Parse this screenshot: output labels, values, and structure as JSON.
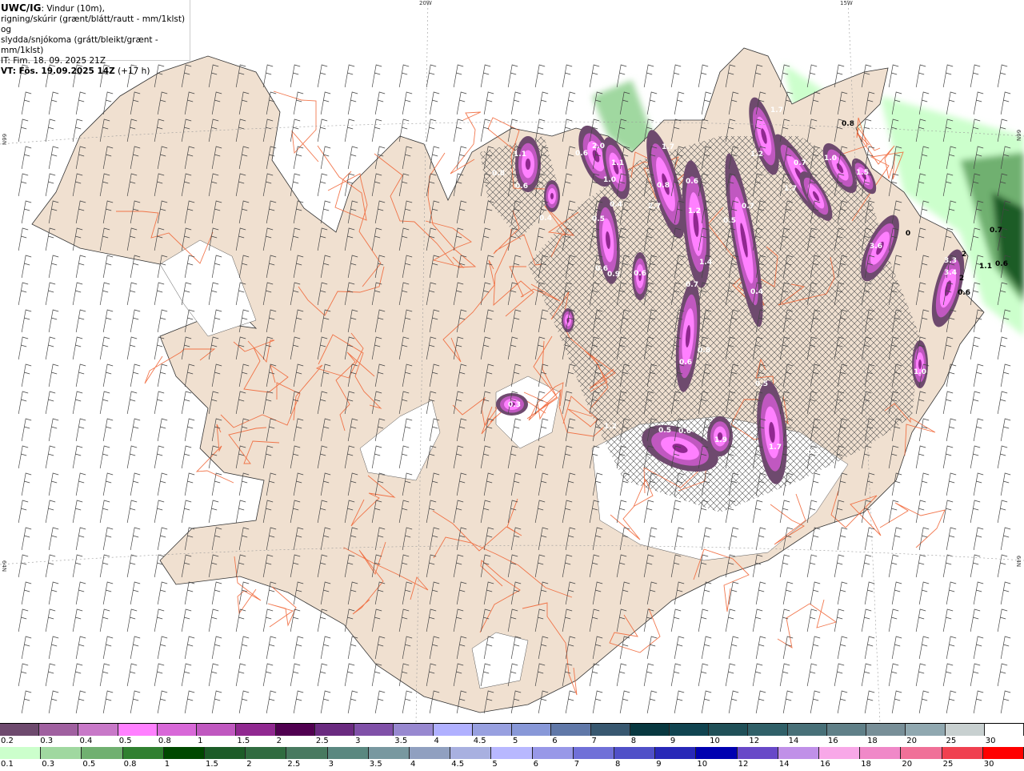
{
  "title": {
    "model": "UWC/IG",
    "line1": ": Vindur (10m),",
    "line2": "rigning/skúrir (grænt/blátt/rautt - mm/1klst) og",
    "line3": "slydda/snjókoma (grátt/bleikt/grænt - mm/1klst)",
    "it": "IT: Fim. 18. 09. 2025 21Z",
    "vt_bold": "VT: Fös. 19.09.2025 14Z",
    "vt_rest": " (+17 h)"
  },
  "graticule": {
    "lon1": "20W",
    "lon2": "15W",
    "lat_left_top": "66N",
    "lat_right_top": "66N",
    "lat_left_bottom": "64N",
    "lat_right_bottom": "64N"
  },
  "legend_snow": {
    "labels": [
      "0.2",
      "0.3",
      "0.4",
      "0.5",
      "0.8",
      "1",
      "1.5",
      "2",
      "2.5",
      "3",
      "3.5",
      "4",
      "4.5",
      "5",
      "6",
      "7",
      "8",
      "9",
      "10",
      "12",
      "14",
      "16",
      "18",
      "20",
      "25",
      "30"
    ],
    "colors": [
      "#6e4a6e",
      "#a060a0",
      "#c878c8",
      "#ff80ff",
      "#d868d8",
      "#c058c0",
      "#902890",
      "#500050",
      "#6a2a80",
      "#8050a8",
      "#9888d0",
      "#b0b0ff",
      "#98a0e0",
      "#8898d8",
      "#6078a8",
      "#385870",
      "#083840",
      "#104450",
      "#205058",
      "#306068",
      "#487078",
      "#608088",
      "#788f98",
      "#90a8b0",
      "#c8d0d0",
      "#ffffff"
    ]
  },
  "legend_rain": {
    "labels": [
      "0.1",
      "0.3",
      "0.5",
      "0.8",
      "1",
      "1.5",
      "2",
      "2.5",
      "3",
      "3.5",
      "4",
      "4.5",
      "5",
      "6",
      "7",
      "8",
      "9",
      "10",
      "12",
      "14",
      "16",
      "18",
      "20",
      "25",
      "30"
    ],
    "colors": [
      "#ccffcc",
      "#a0d8a0",
      "#70b070",
      "#308030",
      "#004800",
      "#1c5c28",
      "#306c40",
      "#487a60",
      "#5a8880",
      "#7898a0",
      "#90a0c0",
      "#a8b0e0",
      "#b8b8ff",
      "#9898e8",
      "#7070d8",
      "#5050c8",
      "#2828b8",
      "#0000b0",
      "#6848c8",
      "#c090e8",
      "#f8a8e8",
      "#f088c8",
      "#f07098",
      "#f04050",
      "#ff0000"
    ]
  },
  "map_colors": {
    "land": "#f0e0d0",
    "roads": "#f06030",
    "glacier": "#ffffff",
    "sea": "#ffffff"
  },
  "precip_values": [
    "2.0",
    "1.1",
    "1.0",
    "0.6",
    "0.5",
    "0.4",
    "0.6",
    "0.9",
    "0.6",
    "1.7",
    "0.8",
    "2.7",
    "0.6",
    "1.2",
    "1.4",
    "0.7",
    "0.5",
    "0.7",
    "0.4",
    "1.2",
    "1.7",
    "0.7",
    "1.0",
    "1.5",
    "1.7",
    "0.8",
    "3.6",
    "0",
    "3.3",
    "3.4",
    "2",
    "2",
    "0.6",
    "1.1",
    "0.6",
    "0.7",
    "1.0",
    "0.8",
    "0.6",
    "0.5",
    "0.3",
    "0.5",
    "0.6",
    "1.9",
    "1.7",
    "0.5",
    "1.2",
    "1.1",
    "0.8",
    "0.6",
    "0.4"
  ]
}
